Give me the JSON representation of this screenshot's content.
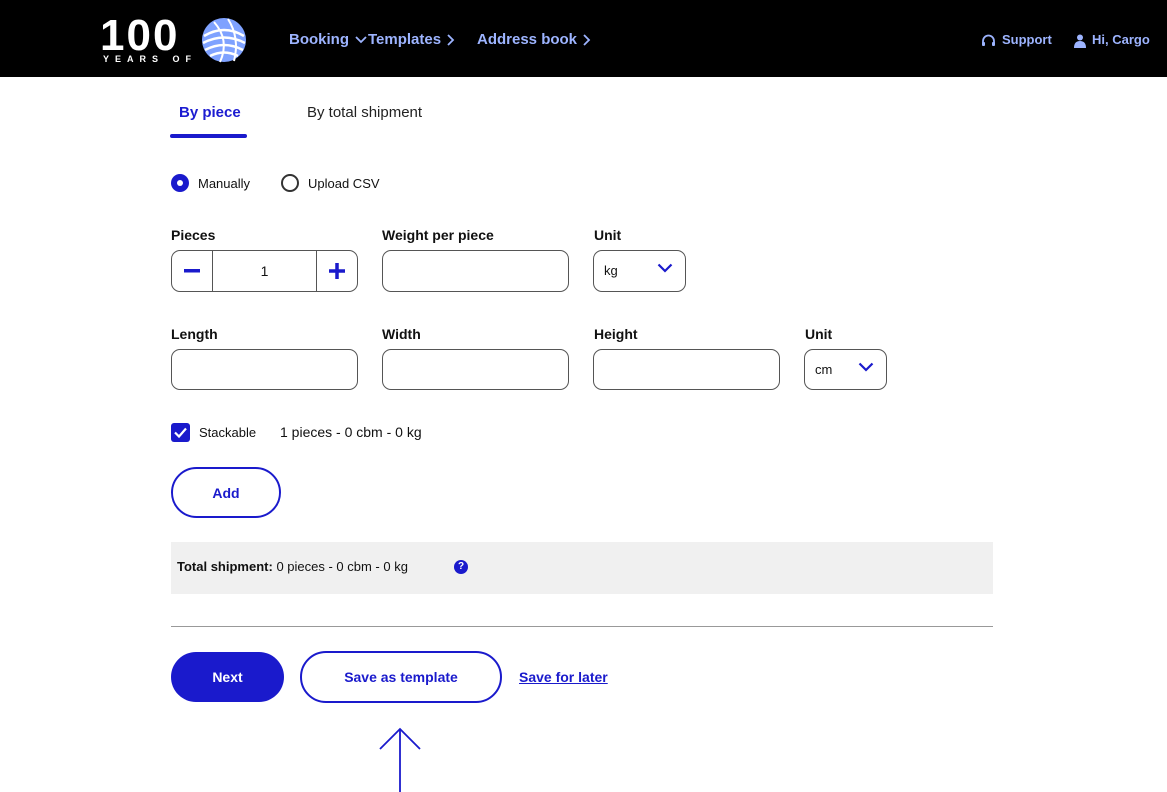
{
  "header": {
    "logo_number": "100",
    "logo_subtext": "YEARS OF",
    "nav": [
      {
        "label": "Booking",
        "chevron": "chevron-down-icon"
      },
      {
        "label": "Templates",
        "chevron": "chevron-right-icon"
      },
      {
        "label": "Address book",
        "chevron": "chevron-right-icon"
      }
    ],
    "support_label": "Support",
    "user_label": "Hi, Cargo"
  },
  "tabs": [
    {
      "label": "By piece",
      "active": true
    },
    {
      "label": "By total shipment",
      "active": false
    }
  ],
  "entry_mode": {
    "options": [
      "Manually",
      "Upload CSV"
    ],
    "selected": "Manually"
  },
  "pieces": {
    "label": "Pieces",
    "value": "1"
  },
  "weight": {
    "label": "Weight per piece",
    "value": "",
    "unit_label": "Unit",
    "unit_value": "kg"
  },
  "dimensions": {
    "length_label": "Length",
    "width_label": "Width",
    "height_label": "Height",
    "unit_label": "Unit",
    "unit_value": "cm"
  },
  "stackable": {
    "label": "Stackable",
    "checked": true,
    "summary": "1 pieces - 0 cbm - 0 kg"
  },
  "add_label": "Add",
  "total": {
    "label": "Total shipment:",
    "value": "0 pieces - 0 cbm - 0 kg",
    "help": "?"
  },
  "actions": {
    "next_label": "Next",
    "save_template_label": "Save as template",
    "save_later_label": "Save for later"
  },
  "colors": {
    "accent": "#1a1acc",
    "header_bg": "#000000",
    "nav_text": "#9db4ff"
  }
}
